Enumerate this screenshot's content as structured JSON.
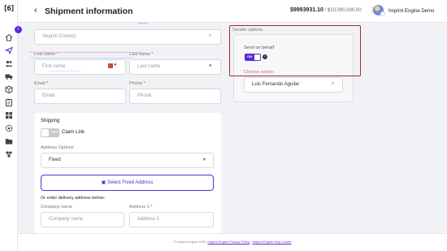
{
  "app": {
    "logo_text": "[6]"
  },
  "sidebar": {
    "collapse_glyph": "›",
    "items": [
      {
        "icon": "home-icon"
      },
      {
        "icon": "send-icon",
        "active": true
      },
      {
        "icon": "people-icon"
      },
      {
        "icon": "truck-icon"
      },
      {
        "icon": "package-icon"
      },
      {
        "icon": "clipboard-icon"
      },
      {
        "icon": "grid-icon"
      },
      {
        "icon": "settings-icon"
      },
      {
        "icon": "folder-icon"
      },
      {
        "icon": "integrations-icon"
      }
    ]
  },
  "header": {
    "back_glyph": "‹",
    "title": "Shipment information",
    "balance": "$9993931.10",
    "balance_limit": " / $10,000,000.00",
    "kebab": "⋮",
    "user_name": "Imprint Engine Demo"
  },
  "contact": {
    "search_placeholder": "Search Contact",
    "first_name_label": "First name",
    "first_name_placeholder": "First name",
    "last_name_label": "Last name",
    "last_name_placeholder": "Last name",
    "email_label": "Email",
    "email_placeholder": "Email",
    "phone_label": "Phone",
    "phone_placeholder": "Phone",
    "required_mark": "*"
  },
  "shipping": {
    "heading": "Shipping",
    "claim_toggle_state": "OFF",
    "claim_link_label": "Claim Link",
    "address_options_label": "Address Options",
    "address_option_value": "Fixed",
    "select_fixed_address": "Select Fixed Address",
    "enter_address_label": "Or enter delivery address below:",
    "company_name_label": "Company name",
    "company_name_placeholder": "Company name",
    "address1_label": "Address 1",
    "address1_placeholder": "Address 1"
  },
  "sender": {
    "section_label": "Sender options",
    "send_on_behalf_label": "Send on behalf",
    "toggle_state": "ON",
    "help_glyph": "?",
    "choose_sender_label": "Choose sender",
    "sender_value": "Luis Fernando Aguilar"
  },
  "footer": {
    "copyright": "© Imprint Engine 2025.",
    "privacy_link": "Imprint Engine Privacy Policy",
    "separator": " | ",
    "help_link": "Imprint Engine Help Center"
  },
  "colors": {
    "accent": "#5b2bd6",
    "highlight_border": "#a52b2b",
    "background": "#f1f2f6"
  }
}
